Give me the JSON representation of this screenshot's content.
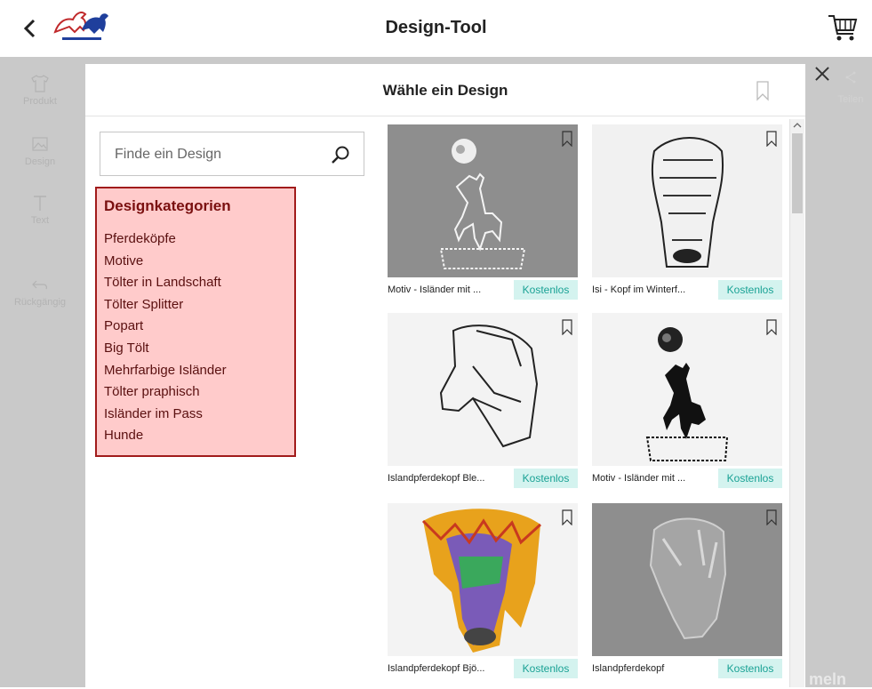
{
  "header": {
    "title": "Design-Tool",
    "logo": "horse-logo",
    "cart_icon": "shopping-cart-icon"
  },
  "toolbar": {
    "items": [
      {
        "label": "Produkt",
        "icon": "tshirt-icon"
      },
      {
        "label": "Design",
        "icon": "image-icon"
      },
      {
        "label": "Text",
        "icon": "text-icon"
      },
      {
        "label": "Rückgängig",
        "icon": "undo-icon"
      }
    ],
    "share_label": "Teilen"
  },
  "background_partial_text": "meln",
  "modal": {
    "title": "Wähle ein Design",
    "search": {
      "placeholder": "Finde ein Design",
      "value": ""
    },
    "categories": {
      "heading": "Designkategorien",
      "items": [
        "Pferdeköpfe",
        "Motive",
        "Tölter in Landschaft",
        "Tölter Splitter",
        "Popart",
        "Big Tölt",
        "Mehrfarbige Isländer",
        "Tölter praphisch",
        "Isländer im Pass",
        "Hunde"
      ]
    },
    "designs": [
      {
        "name": "Motiv - Isländer mit ...",
        "price": "Kostenlos"
      },
      {
        "name": "Isi - Kopf im Winterf...",
        "price": "Kostenlos"
      },
      {
        "name": "Islandpferdekopf Ble...",
        "price": "Kostenlos"
      },
      {
        "name": "Motiv - Isländer mit ...",
        "price": "Kostenlos"
      },
      {
        "name": "Islandpferdekopf Bjö...",
        "price": "Kostenlos"
      },
      {
        "name": "Islandpferdekopf",
        "price": "Kostenlos"
      }
    ]
  },
  "colors": {
    "category_bg": "#ffcbcb",
    "category_border": "#a11b1b",
    "price_bg": "#d4f3ef",
    "price_text": "#1aa295",
    "backdrop": "#c9c9c9"
  }
}
